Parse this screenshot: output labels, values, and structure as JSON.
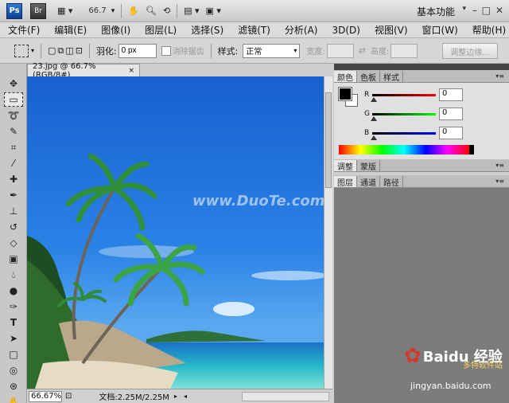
{
  "appbar": {
    "ps_label": "Ps",
    "br_label": "Br",
    "zoom_value": "66.7",
    "workspace_label": "基本功能"
  },
  "window_controls": {
    "minimize": "–",
    "restore": "□",
    "close": "✕"
  },
  "menu": {
    "items": [
      "文件(F)",
      "编辑(E)",
      "图像(I)",
      "图层(L)",
      "选择(S)",
      "滤镜(T)",
      "分析(A)",
      "3D(D)",
      "视图(V)",
      "窗口(W)",
      "帮助(H)"
    ]
  },
  "options": {
    "feather_label": "羽化:",
    "feather_value": "0 px",
    "antialias_label": "消除锯齿",
    "style_label": "样式:",
    "style_value": "正常",
    "width_label": "宽度:",
    "height_label": "高度:",
    "refine_label": "调整边缘..."
  },
  "document": {
    "tab_label": "23.jpg @ 66.7%(RGB/8#)",
    "close_label": "×",
    "status_zoom": "66.67%",
    "status_doc": "文档:2.25M/2.25M",
    "watermark": "www.DuoTe.com"
  },
  "panels": {
    "color_tabs": [
      "颜色",
      "色板",
      "样式"
    ],
    "r_label": "R",
    "g_label": "G",
    "b_label": "B",
    "r_value": "0",
    "g_value": "0",
    "b_value": "0",
    "adjust_tabs": [
      "调整",
      "蒙版"
    ],
    "layer_tabs": [
      "图层",
      "通道",
      "路径"
    ]
  },
  "overlay": {
    "baidu_brand": "Baidu 经验",
    "baidu_url": "jingyan.baidu.com",
    "site_label": "多特软件站"
  },
  "colors": {
    "accent": "#2a62c8",
    "sky": "#1a6fd6",
    "panel": "#e0e0e0"
  }
}
